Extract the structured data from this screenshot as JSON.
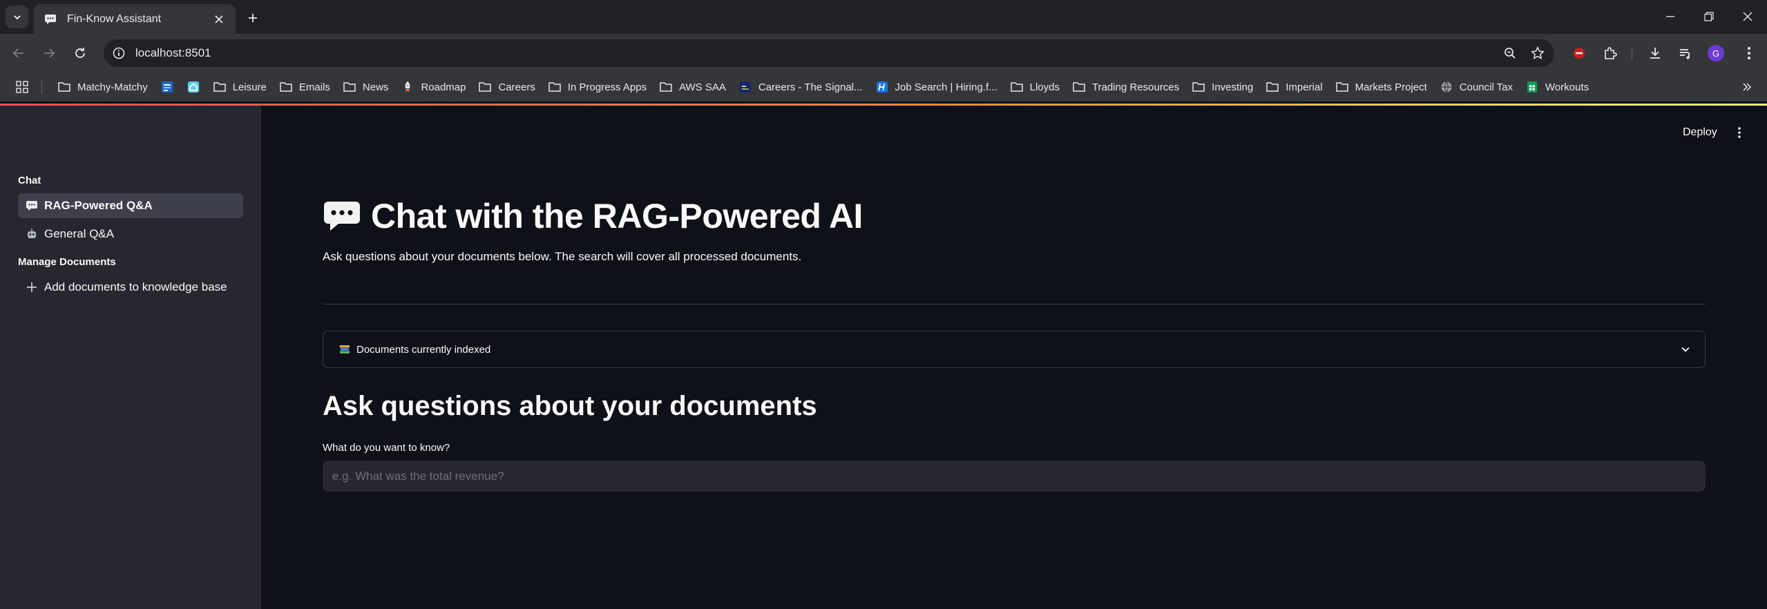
{
  "browser": {
    "tab": {
      "title": "Fin-Know Assistant"
    },
    "address": {
      "url": "localhost:8501"
    },
    "profile_initial": "G",
    "bookmarks": [
      {
        "label": "Matchy-Matchy",
        "icon": "folder-icon"
      },
      {
        "label": "",
        "icon": "site-icon-blue"
      },
      {
        "label": "",
        "icon": "home-icon"
      },
      {
        "label": "Leisure",
        "icon": "folder-icon"
      },
      {
        "label": "Emails",
        "icon": "folder-icon"
      },
      {
        "label": "News",
        "icon": "folder-icon"
      },
      {
        "label": "Roadmap",
        "icon": "rocket-icon"
      },
      {
        "label": "Careers",
        "icon": "folder-icon"
      },
      {
        "label": "In Progress Apps",
        "icon": "folder-icon"
      },
      {
        "label": "AWS SAA",
        "icon": "folder-icon"
      },
      {
        "label": "Careers - The Signal...",
        "icon": "site-icon-navy"
      },
      {
        "label": "Job Search | Hiring.f...",
        "icon": "site-icon-h"
      },
      {
        "label": "Lloyds",
        "icon": "folder-icon"
      },
      {
        "label": "Trading Resources",
        "icon": "folder-icon"
      },
      {
        "label": "Investing",
        "icon": "folder-icon"
      },
      {
        "label": "Imperial",
        "icon": "folder-icon"
      },
      {
        "label": "Markets Project",
        "icon": "folder-icon"
      },
      {
        "label": "Council Tax",
        "icon": "globe-icon"
      },
      {
        "label": "Workouts",
        "icon": "sheets-icon"
      }
    ]
  },
  "app": {
    "deploy_label": "Deploy",
    "sidebar": {
      "chat_heading": "Chat",
      "chat_items": [
        {
          "label": "RAG-Powered Q&A",
          "icon": "speech-bubble-icon",
          "active": true
        },
        {
          "label": "General Q&A",
          "icon": "robot-icon",
          "active": false
        }
      ],
      "manage_heading": "Manage Documents",
      "manage_items": [
        {
          "label": "Add documents to knowledge base",
          "icon": "plus-icon"
        }
      ]
    },
    "main": {
      "title": "Chat with the RAG-Powered AI",
      "subtitle": "Ask questions about your documents below. The search will cover all processed documents.",
      "expander_label": "Documents currently indexed",
      "section_heading": "Ask questions about your documents",
      "input_label": "What do you want to know?",
      "input_placeholder": "e.g. What was the total revenue?",
      "input_value": ""
    }
  }
}
